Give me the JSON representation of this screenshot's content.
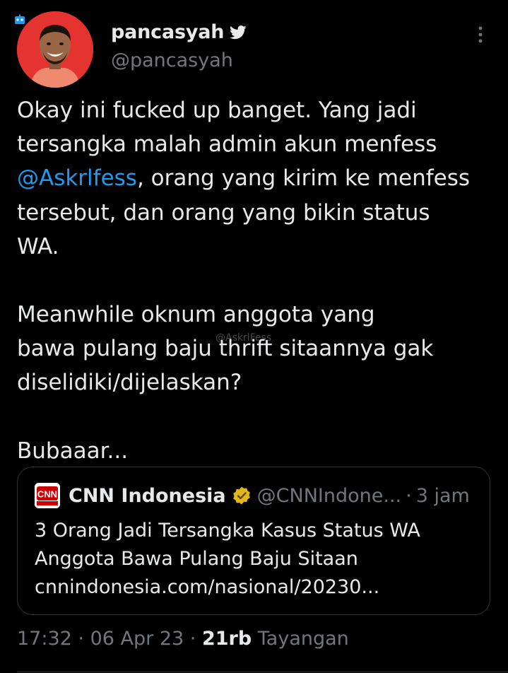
{
  "colors": {
    "background": "#000000",
    "text_primary": "#e7e9ea",
    "text_secondary": "#71767b",
    "accent": "#1d9bf0",
    "border": "#2f3336",
    "avatar_bg": "#e5342f",
    "verified_gold": "#e2b719",
    "cnn_red": "#cc0000"
  },
  "tweet": {
    "author": {
      "display_name": "pancasyah",
      "handle": "@pancasyah",
      "verified_icon": "bird-icon"
    },
    "more_icon": "more-vertical-icon",
    "body": {
      "line1": "Okay ini fucked up banget. Yang jadi",
      "line2": "tersangka malah admin akun menfess",
      "mention": "@Askrlfess",
      "line3_rest": ", orang yang kirim ke menfess",
      "line4": "tersebut, dan orang yang bikin status",
      "line5": "WA.",
      "line6": "Meanwhile oknum anggota yang",
      "line7": "bawa pulang baju thrift sitaannya gak",
      "line8": "diselidiki/dijelaskan?",
      "line9": "Bubaaar..."
    },
    "watermark": "@AskrlFess",
    "quote": {
      "logo_icon": "cnn-logo-icon",
      "name": "CNN Indonesia",
      "verified_icon": "gold-verified-icon",
      "handle": "@CNNIndone...",
      "separator": "·",
      "time": "3 jam",
      "text_line1": "3 Orang Jadi Tersangka Kasus Status WA",
      "text_line2": "Anggota Bawa Pulang Baju Sitaan",
      "text_line3": "cnnindonesia.com/nasional/20230..."
    },
    "meta": {
      "time": "17:32",
      "dot1": "·",
      "date": "06 Apr 23",
      "dot2": "·",
      "views_count": "21rb",
      "views_label": "Tayangan"
    }
  }
}
